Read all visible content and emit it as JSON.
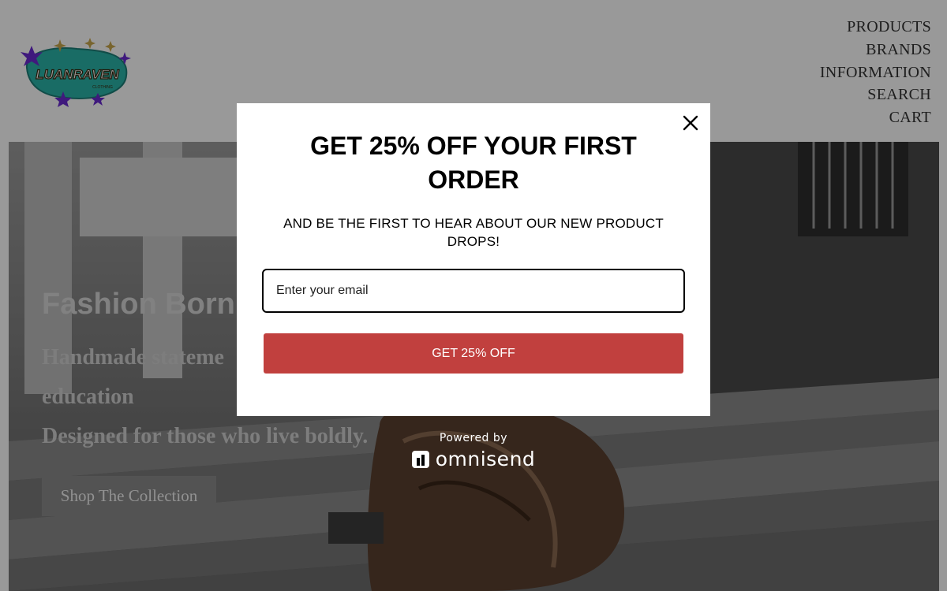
{
  "brand": {
    "name": "LUANRAVEN",
    "tagline": "CLOTHING"
  },
  "nav": {
    "items": [
      "PRODUCTS",
      "BRANDS",
      "INFORMATION",
      "SEARCH",
      "CART"
    ]
  },
  "hero": {
    "title": "Fashion Born",
    "line1": "Handmade stateme",
    "line2": "education",
    "line3": "Designed for those who live boldly.",
    "cta_label": "Shop The Collection"
  },
  "popup": {
    "title": "GET 25% OFF YOUR FIRST ORDER",
    "subtitle": "AND BE THE FIRST TO HEAR ABOUT OUR NEW PRODUCT DROPS!",
    "email_placeholder": "Enter your email",
    "submit_label": "GET 25% OFF",
    "close_icon": "close-icon"
  },
  "powered_by": {
    "label": "Powered by",
    "name": "omnisend"
  },
  "colors": {
    "accent_button": "#c1403e",
    "overlay": "rgba(0,0,0,0.4)",
    "logo_teal": "#2bb5a8",
    "logo_purple": "#6a2bd1"
  }
}
